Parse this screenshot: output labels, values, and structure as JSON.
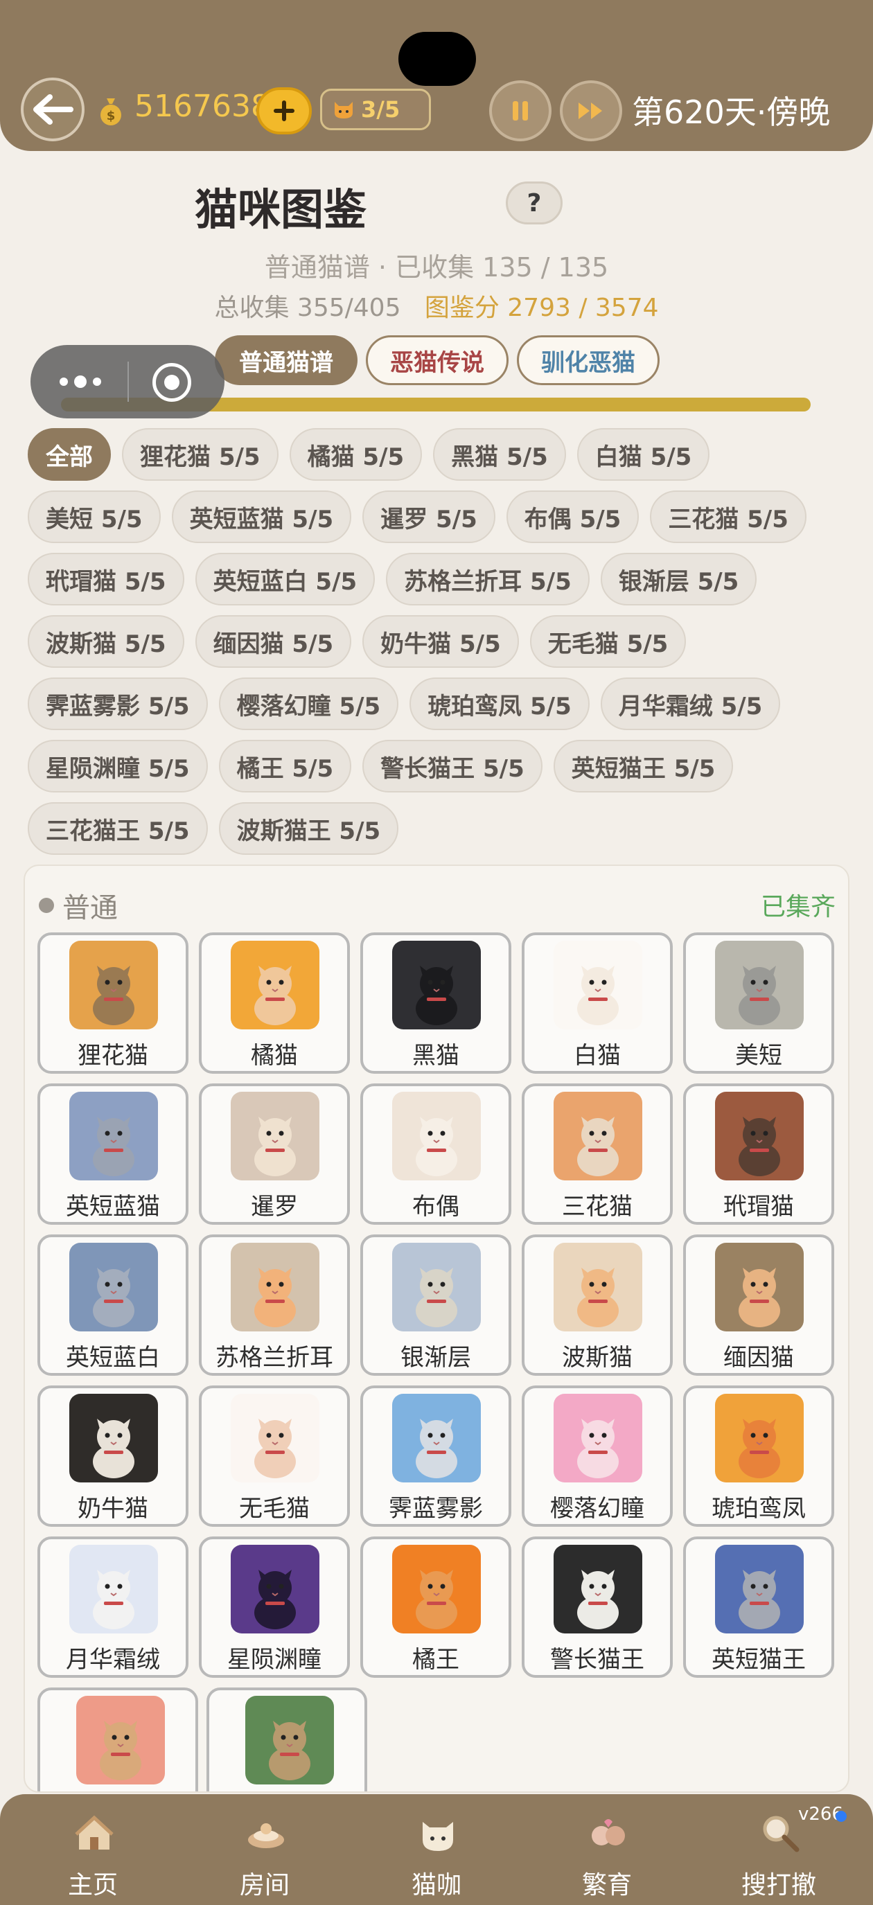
{
  "topbar": {
    "money": "5167638",
    "cat_count": "3/5",
    "day_label": "第620天·傍晚"
  },
  "header": {
    "title": "猫咪图鉴",
    "help": "?",
    "sub_line1": "普通猫谱 · 已收集 135 / 135",
    "total_prefix": "总收集 355/405",
    "score_text": "图鉴分 2793 / 3574"
  },
  "tabs": [
    {
      "label": "普通猫谱"
    },
    {
      "label": "恶猫传说"
    },
    {
      "label": "驯化恶猫"
    }
  ],
  "filters": [
    "全部",
    "狸花猫 5/5",
    "橘猫 5/5",
    "黑猫 5/5",
    "白猫 5/5",
    "美短 5/5",
    "英短蓝猫 5/5",
    "暹罗 5/5",
    "布偶 5/5",
    "三花猫 5/5",
    "玳瑁猫 5/5",
    "英短蓝白 5/5",
    "苏格兰折耳 5/5",
    "银渐层 5/5",
    "波斯猫 5/5",
    "缅因猫 5/5",
    "奶牛猫 5/5",
    "无毛猫 5/5",
    "霁蓝雾影 5/5",
    "樱落幻瞳 5/5",
    "琥珀鸾凤 5/5",
    "月华霜绒 5/5",
    "星陨渊瞳 5/5",
    "橘王 5/5",
    "警长猫王 5/5",
    "英短猫王 5/5",
    "三花猫王 5/5",
    "波斯猫王 5/5"
  ],
  "section": {
    "label": "普通",
    "status": "已集齐"
  },
  "cats": [
    {
      "name": "狸花猫",
      "bg": "#e5a24b",
      "fur": "#9a7a52"
    },
    {
      "name": "橘猫",
      "bg": "#f2a738",
      "fur": "#f0c79a"
    },
    {
      "name": "黑猫",
      "bg": "#2f2f33",
      "fur": "#1b1b1e"
    },
    {
      "name": "白猫",
      "bg": "#fbf8f4",
      "fur": "#f4ebe0"
    },
    {
      "name": "美短",
      "bg": "#b9b7ad",
      "fur": "#9a9a96"
    },
    {
      "name": "英短蓝猫",
      "bg": "#8da0c3",
      "fur": "#9aa3b3"
    },
    {
      "name": "暹罗",
      "bg": "#d9c8b8",
      "fur": "#efe1cf"
    },
    {
      "name": "布偶",
      "bg": "#efe4d8",
      "fur": "#f6efe6"
    },
    {
      "name": "三花猫",
      "bg": "#eaa46d",
      "fur": "#e9d6c0"
    },
    {
      "name": "玳瑁猫",
      "bg": "#9c5a3f",
      "fur": "#5a4033"
    },
    {
      "name": "英短蓝白",
      "bg": "#7f96b8",
      "fur": "#a3adbd"
    },
    {
      "name": "苏格兰折耳",
      "bg": "#d3c2ad",
      "fur": "#f2b27a"
    },
    {
      "name": "银渐层",
      "bg": "#b8c5d6",
      "fur": "#d8d4c8"
    },
    {
      "name": "波斯猫",
      "bg": "#ead6bd",
      "fur": "#f0b985"
    },
    {
      "name": "缅因猫",
      "bg": "#9a8262",
      "fur": "#e7b382"
    },
    {
      "name": "奶牛猫",
      "bg": "#2f2c29",
      "fur": "#e8e2d8"
    },
    {
      "name": "无毛猫",
      "bg": "#fbf6f2",
      "fur": "#f0cfb8"
    },
    {
      "name": "霁蓝雾影",
      "bg": "#7fb2e0",
      "fur": "#d4dbe3"
    },
    {
      "name": "樱落幻瞳",
      "bg": "#f3a9c6",
      "fur": "#f7dbe3"
    },
    {
      "name": "琥珀鸾凤",
      "bg": "#f0a23a",
      "fur": "#e8823a"
    },
    {
      "name": "月华霜绒",
      "bg": "#e1e7f3",
      "fur": "#f2f2f2"
    },
    {
      "name": "星陨渊瞳",
      "bg": "#5a3a8a",
      "fur": "#241a38"
    },
    {
      "name": "橘王",
      "bg": "#f08024",
      "fur": "#e99a52"
    },
    {
      "name": "警长猫王",
      "bg": "#2c2c2c",
      "fur": "#ecebe6"
    },
    {
      "name": "英短猫王",
      "bg": "#556fb3",
      "fur": "#a3a8b3"
    },
    {
      "name": "",
      "bg": "#ee9b88",
      "fur": "#d9a97a"
    },
    {
      "name": "",
      "bg": "#5f8a55",
      "fur": "#b79a6e"
    }
  ],
  "nav": [
    {
      "label": "主页"
    },
    {
      "label": "房间"
    },
    {
      "label": "猫咖"
    },
    {
      "label": "繁育"
    },
    {
      "label": "搜打撤"
    }
  ],
  "version": "v266"
}
